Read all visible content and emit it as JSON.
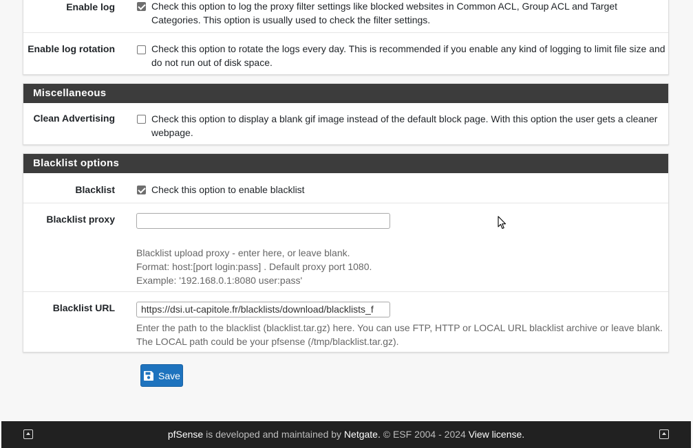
{
  "logging": {
    "enable_log": {
      "label": "Enable log",
      "checked": true,
      "description": "Check this option to log the proxy filter settings like blocked websites in Common ACL, Group ACL and Target Categories. This option is usually used to check the filter settings."
    },
    "enable_log_rotation": {
      "label": "Enable log rotation",
      "checked": false,
      "description": "Check this option to rotate the logs every day. This is recommended if you enable any kind of logging to limit file size and do not run out of disk space."
    }
  },
  "miscellaneous": {
    "heading": "Miscellaneous",
    "clean_advertising": {
      "label": "Clean Advertising",
      "checked": false,
      "description": "Check this option to display a blank gif image instead of the default block page. With this option the user gets a cleaner webpage."
    }
  },
  "blacklist_options": {
    "heading": "Blacklist options",
    "blacklist": {
      "label": "Blacklist",
      "checked": true,
      "description": "Check this option to enable blacklist"
    },
    "blacklist_proxy": {
      "label": "Blacklist proxy",
      "value": "",
      "help_line1": "Blacklist upload proxy - enter here, or leave blank.",
      "help_line2": "Format: host:[port login:pass] . Default proxy port 1080.",
      "help_line3": "Example: '192.168.0.1:8080 user:pass'"
    },
    "blacklist_url": {
      "label": "Blacklist URL",
      "value": "https://dsi.ut-capitole.fr/blacklists/download/blacklists_f",
      "help_line1": "Enter the path to the blacklist (blacklist.tar.gz) here. You can use FTP, HTTP or LOCAL URL blacklist archive or leave blank.",
      "help_line2": "The LOCAL path could be your pfsense (/tmp/blacklist.tar.gz)."
    }
  },
  "save_label": "Save",
  "footer": {
    "brand": "pfSense",
    "developed_text": " is developed and maintained by ",
    "company": "Netgate.",
    "copyright": " © ESF 2004 - 2024 ",
    "license_link": "View license."
  },
  "colors": {
    "panel_heading_bg": "#3c3c3c",
    "save_button_bg": "#1e73be",
    "footer_bg": "#212121"
  }
}
